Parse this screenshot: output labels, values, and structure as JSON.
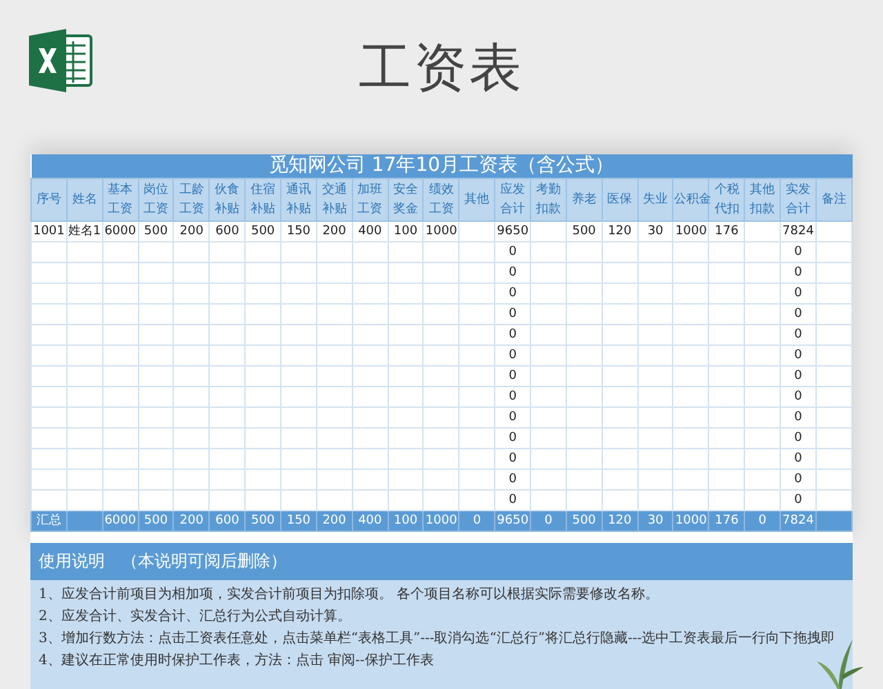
{
  "page_title": "工资表",
  "sheet": {
    "title": "觅知网公司 17年10月工资表（含公式）",
    "columns": [
      {
        "lines": [
          "序号"
        ]
      },
      {
        "lines": [
          "姓名"
        ]
      },
      {
        "lines": [
          "基本",
          "工资"
        ]
      },
      {
        "lines": [
          "岗位",
          "工资"
        ]
      },
      {
        "lines": [
          "工龄",
          "工资"
        ]
      },
      {
        "lines": [
          "伙食",
          "补贴"
        ]
      },
      {
        "lines": [
          "住宿",
          "补贴"
        ]
      },
      {
        "lines": [
          "通讯",
          "补贴"
        ]
      },
      {
        "lines": [
          "交通",
          "补贴"
        ]
      },
      {
        "lines": [
          "加班",
          "工资"
        ]
      },
      {
        "lines": [
          "安全",
          "奖金"
        ]
      },
      {
        "lines": [
          "绩效",
          "工资"
        ]
      },
      {
        "lines": [
          "其他"
        ]
      },
      {
        "lines": [
          "应发",
          "合计"
        ]
      },
      {
        "lines": [
          "考勤",
          "扣款"
        ]
      },
      {
        "lines": [
          "养老"
        ]
      },
      {
        "lines": [
          "医保"
        ]
      },
      {
        "lines": [
          "失业"
        ]
      },
      {
        "lines": [
          "公积金"
        ]
      },
      {
        "lines": [
          "个税",
          "代扣"
        ]
      },
      {
        "lines": [
          "其他",
          "扣款"
        ]
      },
      {
        "lines": [
          "实发",
          "合计"
        ]
      },
      {
        "lines": [
          "备注"
        ]
      }
    ],
    "rows": [
      [
        "1001",
        "姓名1",
        "6000",
        "500",
        "200",
        "600",
        "500",
        "150",
        "200",
        "400",
        "100",
        "1000",
        null,
        "9650",
        null,
        "500",
        "120",
        "30",
        "1000",
        "176",
        null,
        "7824",
        null
      ],
      [
        null,
        null,
        null,
        null,
        null,
        null,
        null,
        null,
        null,
        null,
        null,
        null,
        null,
        "0",
        null,
        null,
        null,
        null,
        null,
        null,
        null,
        "0",
        null
      ],
      [
        null,
        null,
        null,
        null,
        null,
        null,
        null,
        null,
        null,
        null,
        null,
        null,
        null,
        "0",
        null,
        null,
        null,
        null,
        null,
        null,
        null,
        "0",
        null
      ],
      [
        null,
        null,
        null,
        null,
        null,
        null,
        null,
        null,
        null,
        null,
        null,
        null,
        null,
        "0",
        null,
        null,
        null,
        null,
        null,
        null,
        null,
        "0",
        null
      ],
      [
        null,
        null,
        null,
        null,
        null,
        null,
        null,
        null,
        null,
        null,
        null,
        null,
        null,
        "0",
        null,
        null,
        null,
        null,
        null,
        null,
        null,
        "0",
        null
      ],
      [
        null,
        null,
        null,
        null,
        null,
        null,
        null,
        null,
        null,
        null,
        null,
        null,
        null,
        "0",
        null,
        null,
        null,
        null,
        null,
        null,
        null,
        "0",
        null
      ],
      [
        null,
        null,
        null,
        null,
        null,
        null,
        null,
        null,
        null,
        null,
        null,
        null,
        null,
        "0",
        null,
        null,
        null,
        null,
        null,
        null,
        null,
        "0",
        null
      ],
      [
        null,
        null,
        null,
        null,
        null,
        null,
        null,
        null,
        null,
        null,
        null,
        null,
        null,
        "0",
        null,
        null,
        null,
        null,
        null,
        null,
        null,
        "0",
        null
      ],
      [
        null,
        null,
        null,
        null,
        null,
        null,
        null,
        null,
        null,
        null,
        null,
        null,
        null,
        "0",
        null,
        null,
        null,
        null,
        null,
        null,
        null,
        "0",
        null
      ],
      [
        null,
        null,
        null,
        null,
        null,
        null,
        null,
        null,
        null,
        null,
        null,
        null,
        null,
        "0",
        null,
        null,
        null,
        null,
        null,
        null,
        null,
        "0",
        null
      ],
      [
        null,
        null,
        null,
        null,
        null,
        null,
        null,
        null,
        null,
        null,
        null,
        null,
        null,
        "0",
        null,
        null,
        null,
        null,
        null,
        null,
        null,
        "0",
        null
      ],
      [
        null,
        null,
        null,
        null,
        null,
        null,
        null,
        null,
        null,
        null,
        null,
        null,
        null,
        "0",
        null,
        null,
        null,
        null,
        null,
        null,
        null,
        "0",
        null
      ],
      [
        null,
        null,
        null,
        null,
        null,
        null,
        null,
        null,
        null,
        null,
        null,
        null,
        null,
        "0",
        null,
        null,
        null,
        null,
        null,
        null,
        null,
        "0",
        null
      ],
      [
        null,
        null,
        null,
        null,
        null,
        null,
        null,
        null,
        null,
        null,
        null,
        null,
        null,
        "0",
        null,
        null,
        null,
        null,
        null,
        null,
        null,
        "0",
        null
      ]
    ],
    "total_row": {
      "label": "汇总",
      "values": [
        "6000",
        "500",
        "200",
        "600",
        "500",
        "150",
        "200",
        "400",
        "100",
        "1000",
        "0",
        "9650",
        "0",
        "500",
        "120",
        "30",
        "1000",
        "176",
        "0",
        "7824"
      ]
    }
  },
  "instructions": {
    "title": "使用说明　（本说明可阅后删除）",
    "lines": [
      "1、应发合计前项目为相加项，实发合计前项目为扣除项。 各个项目名称可以根据实际需要修改名称。",
      "2、应发合计、实发合计、汇总行为公式自动计算。",
      "3、增加行数方法：点击工资表任意处，点击菜单栏“表格工具”---取消勾选“汇总行”将汇总行隐藏---选中工资表最后一行向下拖拽即",
      "4、建议在正常使用时保护工作表，方法：点击 审阅--保护工作表"
    ]
  }
}
